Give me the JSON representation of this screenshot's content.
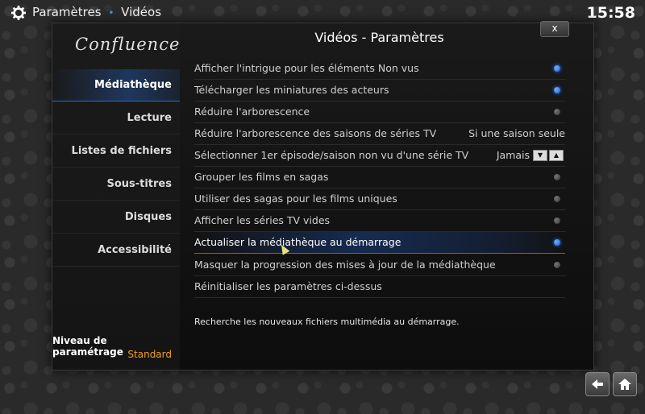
{
  "header": {
    "section": "Paramètres",
    "separator": "•",
    "page": "Vidéos",
    "clock": "15:58",
    "icon": "gear-icon"
  },
  "dialog": {
    "title": "Vidéos - Paramètres",
    "close_label": "x"
  },
  "sidebar": {
    "logo": "Confluence",
    "items": [
      {
        "label": "Médiathèque",
        "active": true
      },
      {
        "label": "Lecture"
      },
      {
        "label": "Listes de fichiers"
      },
      {
        "label": "Sous-titres"
      },
      {
        "label": "Disques"
      },
      {
        "label": "Accessibilité"
      }
    ],
    "level_label": "Niveau de paramétrage",
    "level_value": "Standard"
  },
  "settings": [
    {
      "label": "Afficher l'intrigue pour les éléments Non vus",
      "type": "toggle",
      "on": true
    },
    {
      "label": "Télécharger les miniatures des acteurs",
      "type": "toggle",
      "on": true
    },
    {
      "label": "Réduire l'arborescence",
      "type": "toggle",
      "on": false
    },
    {
      "label": "Réduire l'arborescence des saisons de séries TV",
      "type": "value",
      "value": "Si une saison seule"
    },
    {
      "label": "Sélectionner 1er épisode/saison non vu d'une série TV",
      "type": "spin",
      "value": "Jamais"
    },
    {
      "label": "Grouper les films en sagas",
      "type": "toggle",
      "on": false
    },
    {
      "label": "Utiliser des sagas pour les films uniques",
      "type": "toggle",
      "on": false
    },
    {
      "label": "Afficher les séries TV vides",
      "type": "toggle",
      "on": false
    },
    {
      "label": "Actualiser la médiathèque au démarrage",
      "type": "toggle",
      "on": true,
      "selected": true
    },
    {
      "label": "Masquer la progression des mises à jour de la médiathèque",
      "type": "toggle",
      "on": false
    },
    {
      "label": "Réinitialiser les paramètres ci-dessus",
      "type": "action"
    }
  ],
  "description": "Recherche les nouveaux fichiers multimédia au démarrage.",
  "colors": {
    "accent": "#2a6ad0",
    "level": "#f0a020"
  },
  "nav": {
    "back_icon": "back-arrow-icon",
    "home_icon": "home-icon"
  }
}
